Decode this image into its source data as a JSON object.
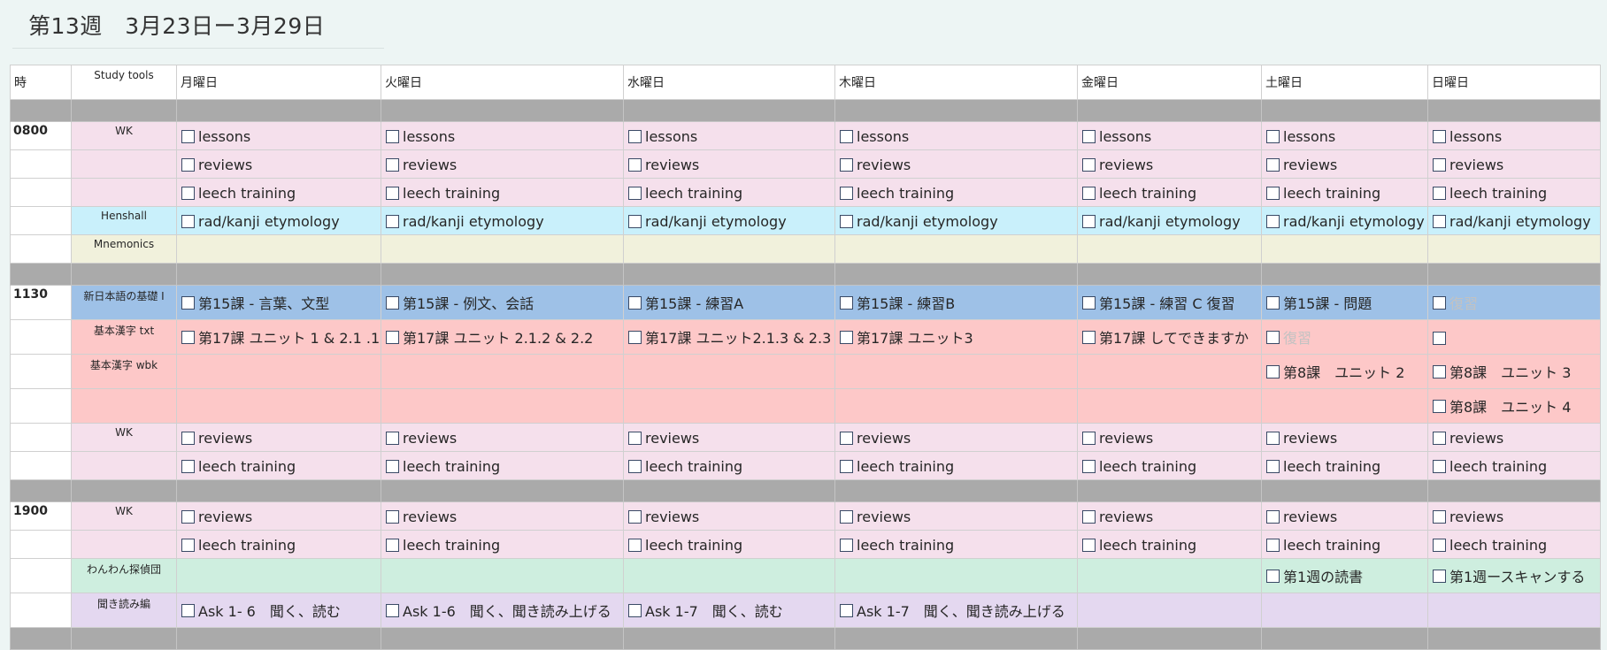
{
  "title": "第13週　3月23日ー3月29日",
  "header": {
    "time": "時",
    "tools": "Study tools",
    "days": [
      "月曜日",
      "火曜日",
      "水曜日",
      "木曜日",
      "金曜日",
      "土曜日",
      "日曜日"
    ]
  },
  "times": {
    "t1": "0800",
    "t2": "1130",
    "t3": "1900"
  },
  "tools": {
    "wk": "WK",
    "henshall": "Henshall",
    "mnemonics": "Mnemonics",
    "shin": "新日本語の基礎 I",
    "kanji_txt": "基本漢字 txt",
    "kanji_wbk": "基本漢字 wbk",
    "wanwan": "わんわん探偵団",
    "kiki": "聞き読み編"
  },
  "tasks": {
    "lessons": "lessons",
    "reviews": "reviews",
    "leech": "leech training",
    "radkanji": "rad/kanji etymology",
    "shin": [
      "第15課 - 言葉、文型",
      "第15課 - 例文、会話",
      "第15課 - 練習A",
      "第15課 - 練習B",
      "第15課 - 練習 C 復習",
      "第15課 - 問題",
      "復習"
    ],
    "kanji_txt": [
      "第17課 ユニット 1 & 2.1 .1",
      "第17課 ユニット 2.1.2 & 2.2",
      "第17課 ユニット2.1.3 & 2.3",
      "第17課 ユニット3",
      "第17課 してできますか",
      "復習",
      ""
    ],
    "kanji_wbk_sat": "第8課　ユニット 2",
    "kanji_wbk_sun": "第8課　ユニット 3",
    "kanji_wbk_sun2": "第8課　ユニット 4",
    "wanwan_sat": "第1週の読書",
    "wanwan_sun": "第1週ースキャンする",
    "kiki": [
      "Ask 1- 6　聞く、読む",
      "Ask 1-6　聞く、聞き読み上げる",
      "Ask 1-7　聞く、読む",
      "Ask 1-7　聞く、聞き読み上げる"
    ]
  }
}
